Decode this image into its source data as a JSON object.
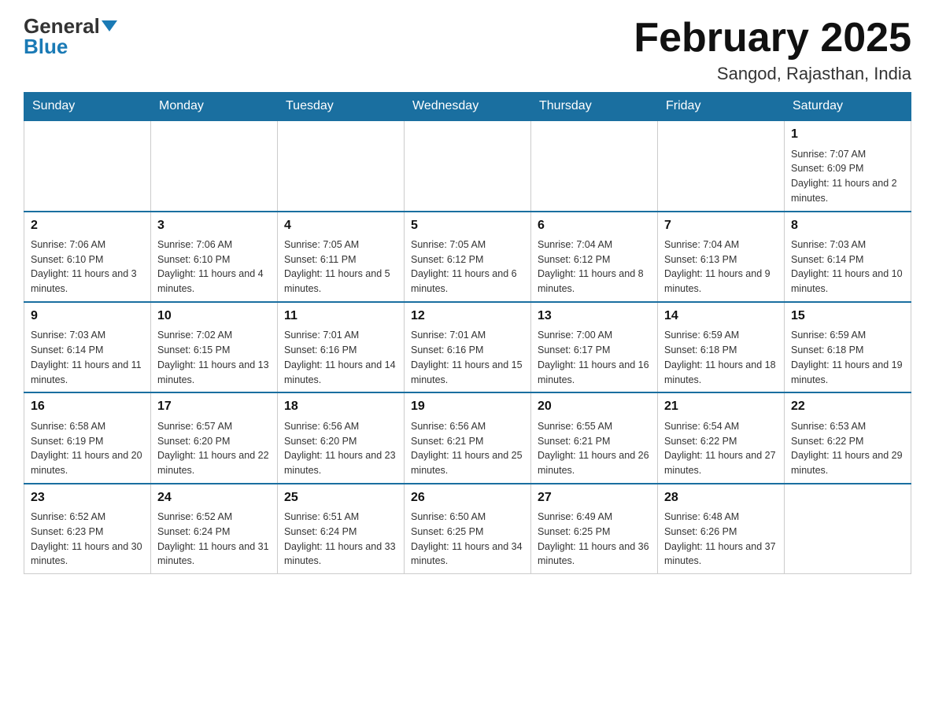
{
  "header": {
    "logo_general": "General",
    "logo_blue": "Blue",
    "month_title": "February 2025",
    "location": "Sangod, Rajasthan, India"
  },
  "weekdays": [
    "Sunday",
    "Monday",
    "Tuesday",
    "Wednesday",
    "Thursday",
    "Friday",
    "Saturday"
  ],
  "weeks": [
    [
      {
        "day": "",
        "info": ""
      },
      {
        "day": "",
        "info": ""
      },
      {
        "day": "",
        "info": ""
      },
      {
        "day": "",
        "info": ""
      },
      {
        "day": "",
        "info": ""
      },
      {
        "day": "",
        "info": ""
      },
      {
        "day": "1",
        "info": "Sunrise: 7:07 AM\nSunset: 6:09 PM\nDaylight: 11 hours and 2 minutes."
      }
    ],
    [
      {
        "day": "2",
        "info": "Sunrise: 7:06 AM\nSunset: 6:10 PM\nDaylight: 11 hours and 3 minutes."
      },
      {
        "day": "3",
        "info": "Sunrise: 7:06 AM\nSunset: 6:10 PM\nDaylight: 11 hours and 4 minutes."
      },
      {
        "day": "4",
        "info": "Sunrise: 7:05 AM\nSunset: 6:11 PM\nDaylight: 11 hours and 5 minutes."
      },
      {
        "day": "5",
        "info": "Sunrise: 7:05 AM\nSunset: 6:12 PM\nDaylight: 11 hours and 6 minutes."
      },
      {
        "day": "6",
        "info": "Sunrise: 7:04 AM\nSunset: 6:12 PM\nDaylight: 11 hours and 8 minutes."
      },
      {
        "day": "7",
        "info": "Sunrise: 7:04 AM\nSunset: 6:13 PM\nDaylight: 11 hours and 9 minutes."
      },
      {
        "day": "8",
        "info": "Sunrise: 7:03 AM\nSunset: 6:14 PM\nDaylight: 11 hours and 10 minutes."
      }
    ],
    [
      {
        "day": "9",
        "info": "Sunrise: 7:03 AM\nSunset: 6:14 PM\nDaylight: 11 hours and 11 minutes."
      },
      {
        "day": "10",
        "info": "Sunrise: 7:02 AM\nSunset: 6:15 PM\nDaylight: 11 hours and 13 minutes."
      },
      {
        "day": "11",
        "info": "Sunrise: 7:01 AM\nSunset: 6:16 PM\nDaylight: 11 hours and 14 minutes."
      },
      {
        "day": "12",
        "info": "Sunrise: 7:01 AM\nSunset: 6:16 PM\nDaylight: 11 hours and 15 minutes."
      },
      {
        "day": "13",
        "info": "Sunrise: 7:00 AM\nSunset: 6:17 PM\nDaylight: 11 hours and 16 minutes."
      },
      {
        "day": "14",
        "info": "Sunrise: 6:59 AM\nSunset: 6:18 PM\nDaylight: 11 hours and 18 minutes."
      },
      {
        "day": "15",
        "info": "Sunrise: 6:59 AM\nSunset: 6:18 PM\nDaylight: 11 hours and 19 minutes."
      }
    ],
    [
      {
        "day": "16",
        "info": "Sunrise: 6:58 AM\nSunset: 6:19 PM\nDaylight: 11 hours and 20 minutes."
      },
      {
        "day": "17",
        "info": "Sunrise: 6:57 AM\nSunset: 6:20 PM\nDaylight: 11 hours and 22 minutes."
      },
      {
        "day": "18",
        "info": "Sunrise: 6:56 AM\nSunset: 6:20 PM\nDaylight: 11 hours and 23 minutes."
      },
      {
        "day": "19",
        "info": "Sunrise: 6:56 AM\nSunset: 6:21 PM\nDaylight: 11 hours and 25 minutes."
      },
      {
        "day": "20",
        "info": "Sunrise: 6:55 AM\nSunset: 6:21 PM\nDaylight: 11 hours and 26 minutes."
      },
      {
        "day": "21",
        "info": "Sunrise: 6:54 AM\nSunset: 6:22 PM\nDaylight: 11 hours and 27 minutes."
      },
      {
        "day": "22",
        "info": "Sunrise: 6:53 AM\nSunset: 6:22 PM\nDaylight: 11 hours and 29 minutes."
      }
    ],
    [
      {
        "day": "23",
        "info": "Sunrise: 6:52 AM\nSunset: 6:23 PM\nDaylight: 11 hours and 30 minutes."
      },
      {
        "day": "24",
        "info": "Sunrise: 6:52 AM\nSunset: 6:24 PM\nDaylight: 11 hours and 31 minutes."
      },
      {
        "day": "25",
        "info": "Sunrise: 6:51 AM\nSunset: 6:24 PM\nDaylight: 11 hours and 33 minutes."
      },
      {
        "day": "26",
        "info": "Sunrise: 6:50 AM\nSunset: 6:25 PM\nDaylight: 11 hours and 34 minutes."
      },
      {
        "day": "27",
        "info": "Sunrise: 6:49 AM\nSunset: 6:25 PM\nDaylight: 11 hours and 36 minutes."
      },
      {
        "day": "28",
        "info": "Sunrise: 6:48 AM\nSunset: 6:26 PM\nDaylight: 11 hours and 37 minutes."
      },
      {
        "day": "",
        "info": ""
      }
    ]
  ]
}
